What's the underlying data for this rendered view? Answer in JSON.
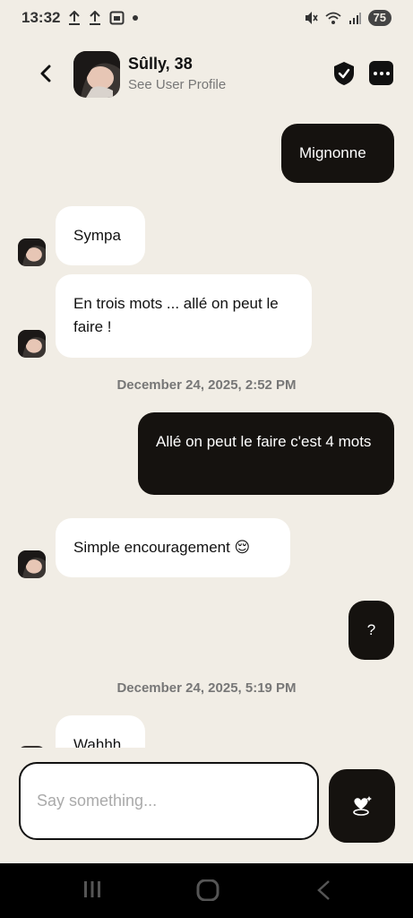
{
  "status_bar": {
    "time": "13:32",
    "battery": "75"
  },
  "header": {
    "name": "Sûlly, 38",
    "subtitle": "See User Profile"
  },
  "messages": [
    {
      "dir": "out",
      "text": "Mignonne"
    },
    {
      "dir": "in",
      "text": "Sympa"
    },
    {
      "dir": "in",
      "text": "En trois mots ... allé on peut le faire !"
    },
    {
      "dir": "timestamp",
      "text": "December 24, 2025, 2:52 PM"
    },
    {
      "dir": "out",
      "text": "Allé on peut le faire c'est 4 mots"
    },
    {
      "dir": "in",
      "text": "Simple encouragement 😌"
    },
    {
      "dir": "out",
      "text": "?"
    },
    {
      "dir": "timestamp",
      "text": "December 24, 2025, 5:19 PM"
    },
    {
      "dir": "in",
      "text": "Wahhh"
    }
  ],
  "composer": {
    "placeholder": "Say something..."
  },
  "icons": {
    "back": "chevron-left-icon",
    "shield": "shield-check-icon",
    "more": "more-dots-icon",
    "send": "heart-sparkle-icon",
    "nav_recent": "recent-apps-icon",
    "nav_home": "home-icon",
    "nav_back": "nav-back-icon"
  },
  "colors": {
    "background": "#f1ede5",
    "outgoing_bubble": "#15120f",
    "incoming_bubble": "#ffffff",
    "timestamp": "#777777"
  }
}
